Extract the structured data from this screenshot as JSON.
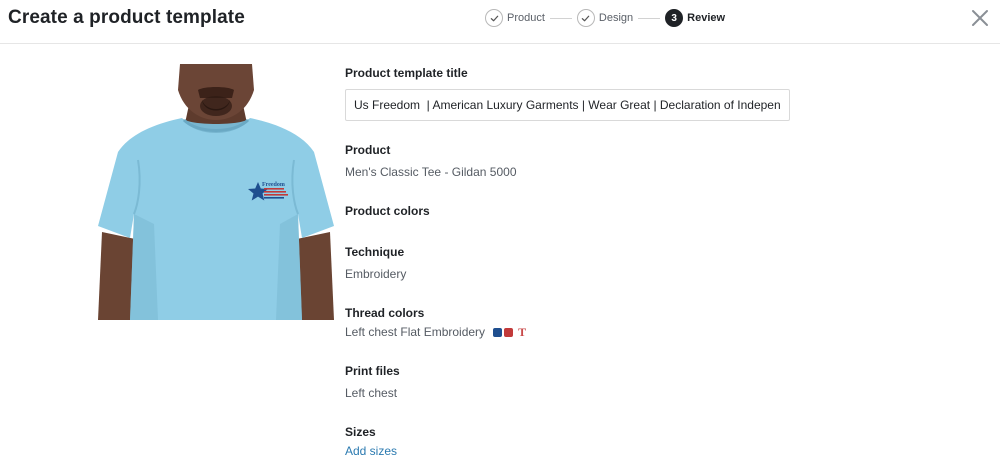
{
  "header": {
    "title": "Create a product template",
    "steps": [
      {
        "label": "Product",
        "state": "done"
      },
      {
        "label": "Design",
        "state": "done"
      },
      {
        "label": "Review",
        "state": "active",
        "number": "3"
      }
    ]
  },
  "preview": {
    "image_alt": "Men's Classic Tee - light blue with left chest Freedom embroidery",
    "embroidery_text": "Freedom"
  },
  "details": {
    "title_label": "Product template title",
    "title_value": "Us Freedom  | American Luxury Garments | Wear Great | Declaration of Independence",
    "product_label": "Product",
    "product_value": "Men's Classic Tee - Gildan 5000",
    "colors_label": "Product colors",
    "technique_label": "Technique",
    "technique_value": "Embroidery",
    "thread_label": "Thread colors",
    "thread_value": "Left chest Flat Embroidery",
    "thread_text_icon": "T",
    "print_label": "Print files",
    "print_value": "Left chest",
    "sizes_label": "Sizes",
    "sizes_link": "Add sizes"
  },
  "colors": {
    "shirt": "#8fcde6",
    "accent": "#2b7ab0",
    "thread_blue": "#1f4f8f",
    "thread_red": "#c23a3a"
  }
}
